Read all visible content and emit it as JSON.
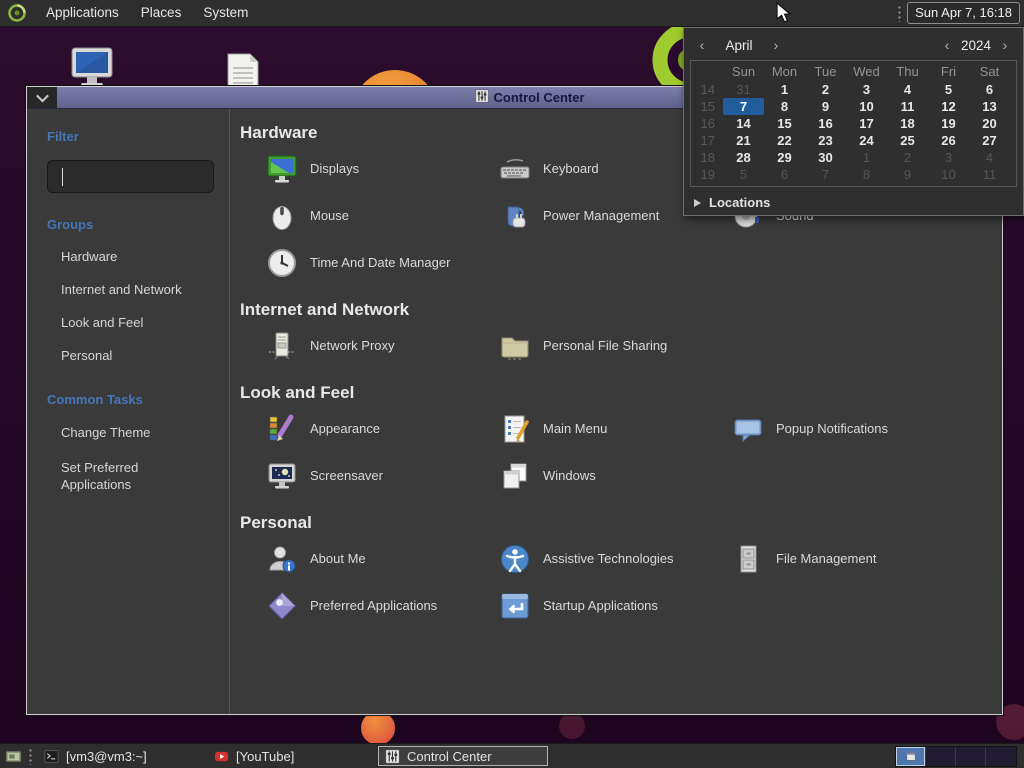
{
  "colors": {
    "selection_blue": "#215d9c",
    "sidebar_header_blue": "#4576b8",
    "titlebar_purple": "#6e6e9c",
    "panel_dark": "#2e2e2e"
  },
  "top_panel": {
    "menus": [
      {
        "label": "Applications"
      },
      {
        "label": "Places"
      },
      {
        "label": "System"
      }
    ],
    "clock": "Sun Apr 7, 16:18"
  },
  "calendar": {
    "month": "April",
    "year": "2024",
    "prev_glyph": "‹",
    "next_glyph": "›",
    "day_headers": [
      "Sun",
      "Mon",
      "Tue",
      "Wed",
      "Thu",
      "Fri",
      "Sat"
    ],
    "weeks": [
      {
        "num": "14",
        "days": [
          {
            "d": "31",
            "dim": true
          },
          {
            "d": "1"
          },
          {
            "d": "2"
          },
          {
            "d": "3"
          },
          {
            "d": "4"
          },
          {
            "d": "5"
          },
          {
            "d": "6"
          }
        ]
      },
      {
        "num": "15",
        "days": [
          {
            "d": "7",
            "sel": true
          },
          {
            "d": "8"
          },
          {
            "d": "9"
          },
          {
            "d": "10"
          },
          {
            "d": "11"
          },
          {
            "d": "12"
          },
          {
            "d": "13"
          }
        ]
      },
      {
        "num": "16",
        "days": [
          {
            "d": "14"
          },
          {
            "d": "15"
          },
          {
            "d": "16"
          },
          {
            "d": "17"
          },
          {
            "d": "18"
          },
          {
            "d": "19"
          },
          {
            "d": "20"
          }
        ]
      },
      {
        "num": "17",
        "days": [
          {
            "d": "21"
          },
          {
            "d": "22"
          },
          {
            "d": "23"
          },
          {
            "d": "24"
          },
          {
            "d": "25"
          },
          {
            "d": "26"
          },
          {
            "d": "27"
          }
        ]
      },
      {
        "num": "18",
        "days": [
          {
            "d": "28"
          },
          {
            "d": "29"
          },
          {
            "d": "30"
          },
          {
            "d": "1",
            "dim": true
          },
          {
            "d": "2",
            "dim": true
          },
          {
            "d": "3",
            "dim": true
          },
          {
            "d": "4",
            "dim": true
          }
        ]
      },
      {
        "num": "19",
        "days": [
          {
            "d": "5",
            "dim": true
          },
          {
            "d": "6",
            "dim": true
          },
          {
            "d": "7",
            "dim": true
          },
          {
            "d": "8",
            "dim": true
          },
          {
            "d": "9",
            "dim": true
          },
          {
            "d": "10",
            "dim": true
          },
          {
            "d": "11",
            "dim": true
          }
        ]
      }
    ],
    "locations_label": "Locations"
  },
  "window": {
    "title": "Control Center",
    "sidebar": {
      "filter_label": "Filter",
      "search_value": "",
      "groups_label": "Groups",
      "groups": [
        {
          "label": "Hardware"
        },
        {
          "label": "Internet and Network"
        },
        {
          "label": "Look and Feel"
        },
        {
          "label": "Personal"
        }
      ],
      "common_tasks_label": "Common Tasks",
      "common_tasks": [
        {
          "label": "Change Theme"
        },
        {
          "label": "Set Preferred Applications"
        }
      ]
    },
    "sections": [
      {
        "title": "Hardware",
        "items": [
          {
            "label": "Displays",
            "icon": "displays-icon"
          },
          {
            "label": "Keyboard",
            "icon": "keyboard-icon"
          },
          {
            "label": "Mouse",
            "icon": "mouse-icon",
            "newrow": true
          },
          {
            "label": "Power Management",
            "icon": "power-management-icon"
          },
          {
            "label": "Sound",
            "icon": "sound-icon"
          },
          {
            "label": "Time And Date Manager",
            "icon": "time-date-icon",
            "newrow": true
          }
        ]
      },
      {
        "title": "Internet and Network",
        "items": [
          {
            "label": "Network Proxy",
            "icon": "network-proxy-icon"
          },
          {
            "label": "Personal File Sharing",
            "icon": "personal-file-sharing-icon"
          }
        ]
      },
      {
        "title": "Look and Feel",
        "items": [
          {
            "label": "Appearance",
            "icon": "appearance-icon"
          },
          {
            "label": "Main Menu",
            "icon": "main-menu-icon"
          },
          {
            "label": "Popup Notifications",
            "icon": "popup-notifications-icon"
          },
          {
            "label": "Screensaver",
            "icon": "screensaver-icon",
            "newrow": true
          },
          {
            "label": "Windows",
            "icon": "windows-icon"
          }
        ]
      },
      {
        "title": "Personal",
        "items": [
          {
            "label": "About Me",
            "icon": "about-me-icon"
          },
          {
            "label": "Assistive Technologies",
            "icon": "assistive-technologies-icon"
          },
          {
            "label": "File Management",
            "icon": "file-management-icon"
          },
          {
            "label": "Preferred Applications",
            "icon": "preferred-applications-icon",
            "newrow": true
          },
          {
            "label": "Startup Applications",
            "icon": "startup-applications-icon"
          }
        ]
      }
    ]
  },
  "taskbar": {
    "tasks": [
      {
        "label": "[vm3@vm3:~]",
        "icon": "terminal-icon",
        "active": false
      },
      {
        "label": "[YouTube]",
        "icon": "youtube-icon",
        "active": false
      },
      {
        "label": "Control Center",
        "icon": "control-center-icon",
        "active": true
      }
    ],
    "workspace_count": 4,
    "active_workspace": 0
  }
}
